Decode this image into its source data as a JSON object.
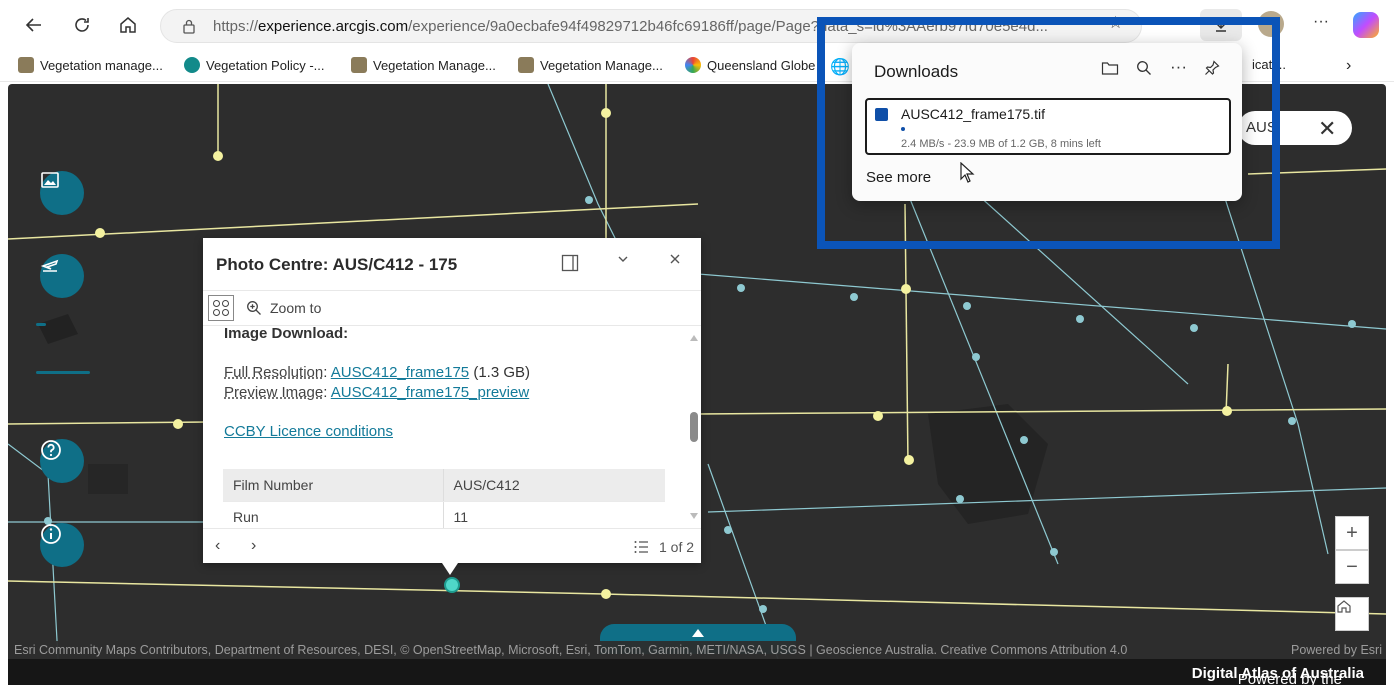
{
  "browser": {
    "url_prefix": "https://",
    "url_host": "experience.arcgis.com",
    "url_path": "/experience/9a0ecbafe94f49829712b46fc69186ff/page/Page?data_s=id%3AAerb97fd70e5e4d...",
    "bookmarks": [
      {
        "label": "Vegetation manage..."
      },
      {
        "label": "Vegetation Policy -..."
      },
      {
        "label": "Vegetation Manage..."
      },
      {
        "label": "Vegetation Manage..."
      },
      {
        "label": "Queensland Globe"
      },
      {
        "label": "icati..."
      }
    ]
  },
  "map": {
    "search_text": "AUS"
  },
  "popup": {
    "title": "Photo Centre: AUS/C412 - 175",
    "zoom_to": "Zoom to",
    "heading": "Image Download:",
    "full_res_label": "Full Resolution",
    "full_res_link": "AUSC412_frame175",
    "full_res_size": "(1.3 GB)",
    "preview_label": "Preview Image",
    "preview_link": "AUSC412_frame175_preview",
    "licence_link": "CCBY Licence conditions",
    "table": [
      {
        "field": "Film Number",
        "value": "AUS/C412"
      },
      {
        "field": "Run",
        "value": "11"
      }
    ],
    "pager": "1 of 2"
  },
  "attribution": {
    "text": "Esri Community Maps Contributors, Department of Resources, DESI, © OpenStreetMap, Microsoft, Esri, TomTom, Garmin, METI/NASA, USGS | Geoscience Australia. Creative Commons Attribution 4.0",
    "powered_esri": "Powered by Esri",
    "powered_prefix": "Powered by the ",
    "powered_bold": "Digital Atlas of Australia"
  },
  "downloads": {
    "title": "Downloads",
    "file_name": "AUSC412_frame175.tif",
    "status": "2.4 MB/s - 23.9 MB of 1.2 GB, 8 mins left",
    "progress_fraction": 0.02,
    "see_more": "See more"
  },
  "colors": {
    "accent": "#0f6f87",
    "highlight": "#0b54b8",
    "road_yellow": "#e8e6a0",
    "road_cyan": "#8ec9d1"
  }
}
